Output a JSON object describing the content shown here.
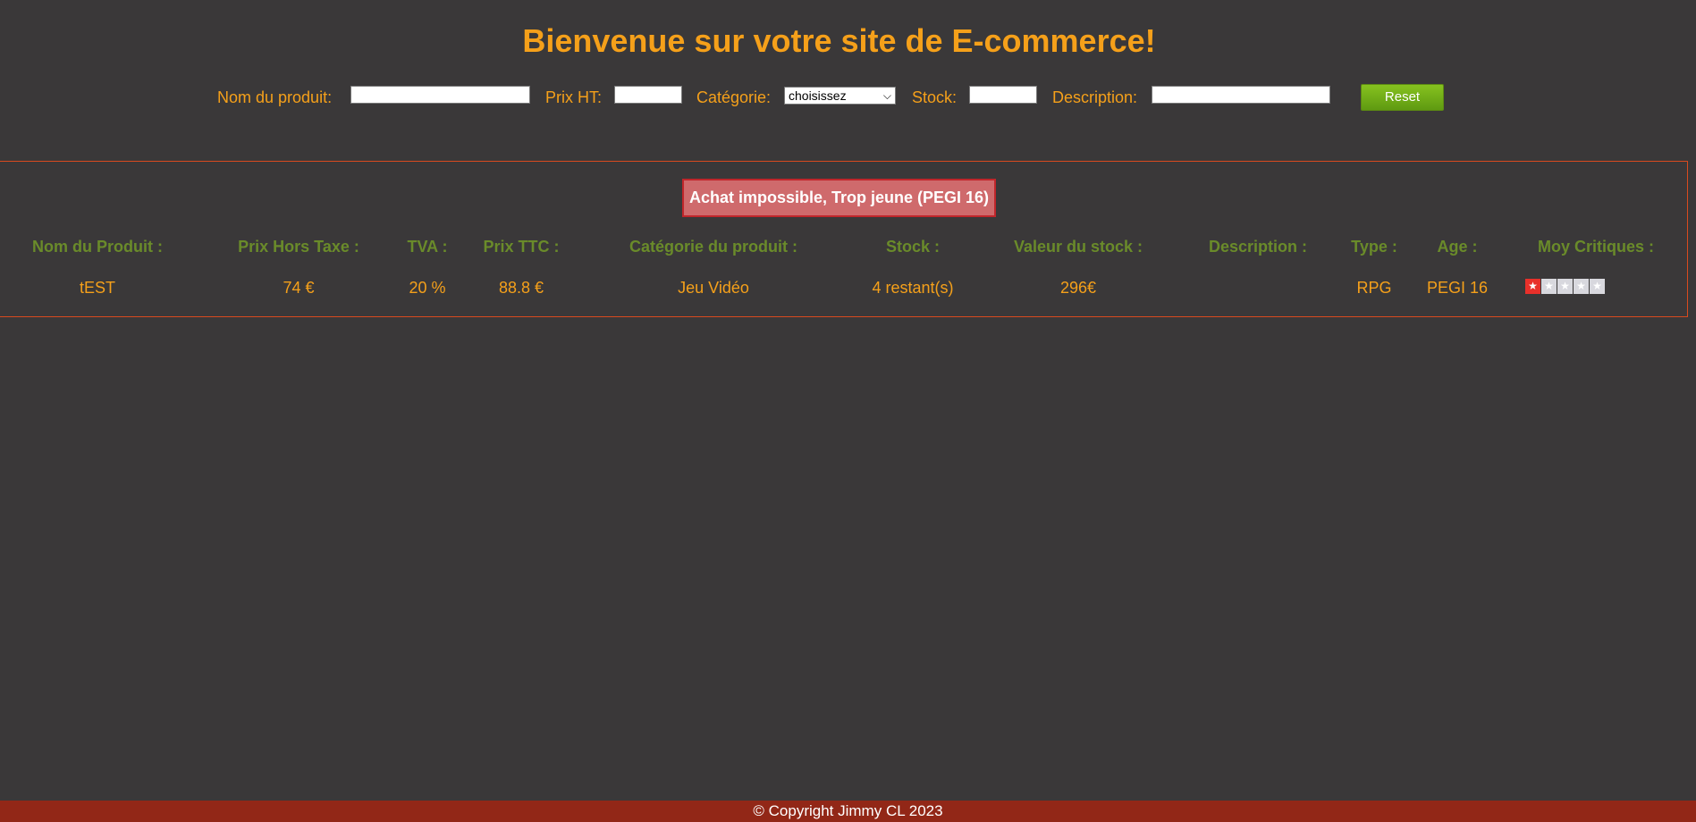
{
  "header": {
    "title": "Bienvenue sur votre site de E-commerce!"
  },
  "filters": {
    "name_label": "Nom du produit:",
    "name_value": "",
    "price_label": "Prix HT:",
    "price_value": "",
    "category_label": "Catégorie:",
    "category_selected": "choisissez",
    "stock_label": "Stock:",
    "stock_value": "",
    "description_label": "Description:",
    "description_value": "",
    "reset_label": "Reset"
  },
  "alert": {
    "text": "Achat impossible, Trop jeune (PEGI 16)"
  },
  "table": {
    "headers": {
      "name": "Nom du Produit :",
      "price_ht": "Prix Hors Taxe :",
      "tva": "TVA :",
      "price_ttc": "Prix TTC :",
      "category": "Catégorie du produit :",
      "stock": "Stock :",
      "stock_value": "Valeur du stock :",
      "description": "Description :",
      "type": "Type :",
      "age": "Age :",
      "rating": "Moy Critiques :"
    },
    "row": {
      "name": "tEST",
      "price_ht": "74 €",
      "tva": "20 %",
      "price_ttc": "88.8 €",
      "category": "Jeu Vidéo",
      "stock": "4 restant(s)",
      "stock_value": "296€",
      "description": "",
      "type": "RPG",
      "age": "PEGI 16",
      "rating": 1,
      "rating_max": 5
    }
  },
  "footer": {
    "text": "© Copyright Jimmy CL 2023"
  },
  "colors": {
    "background": "#3a3839",
    "accent_orange": "#f5a01a",
    "header_green": "#6a8b2a",
    "button_green": "#6fae17",
    "panel_border": "#d84a1e",
    "alert_bg": "#cf6a6c",
    "star_on": "#e8302a",
    "footer_bg": "#922717"
  }
}
